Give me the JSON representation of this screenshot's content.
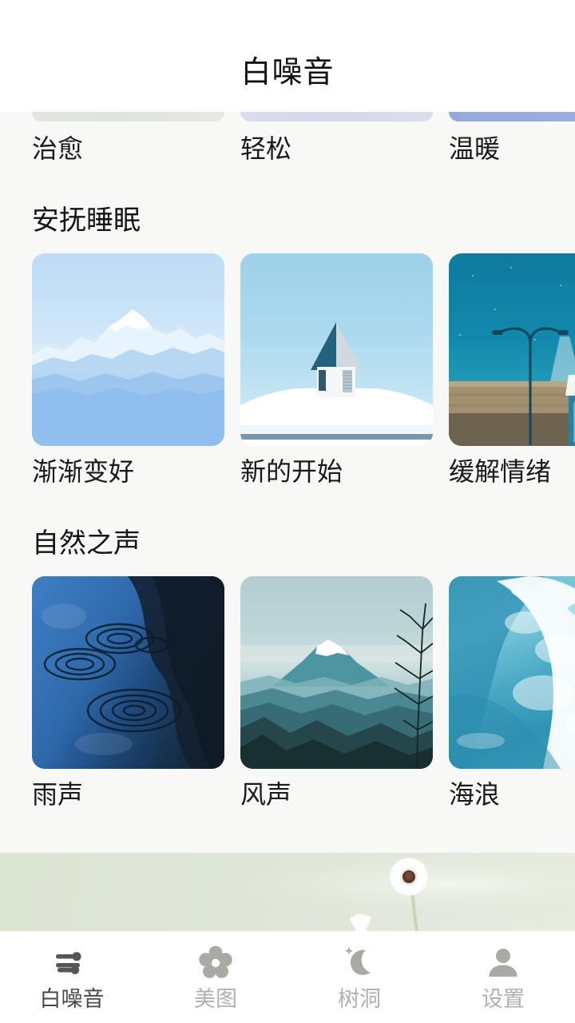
{
  "header": {
    "title": "白噪音"
  },
  "sections": [
    {
      "name": "partial-top",
      "title": "",
      "cards": [
        {
          "label": "治愈",
          "art": "healing",
          "color": "#dfe3e0"
        },
        {
          "label": "轻松",
          "art": "relax",
          "color": "#d6dbe8"
        },
        {
          "label": "温暖",
          "art": "warm",
          "color": "#9aabd8"
        }
      ]
    },
    {
      "name": "soothe-sleep",
      "title": "安抚睡眠",
      "cards": [
        {
          "label": "渐渐变好",
          "art": "snow-mountain",
          "color": "#a8cdee"
        },
        {
          "label": "新的开始",
          "art": "snow-house",
          "color": "#9fd0e8"
        },
        {
          "label": "缓解情绪",
          "art": "street-lamp",
          "color": "#1a7fa8"
        }
      ]
    },
    {
      "name": "nature-sounds",
      "title": "自然之声",
      "cards": [
        {
          "label": "雨声",
          "art": "rain-ripples",
          "color": "#2a62a8"
        },
        {
          "label": "风声",
          "art": "fuji-mountain",
          "color": "#a9c8ca"
        },
        {
          "label": "海浪",
          "art": "ocean-wave",
          "color": "#64bed2"
        }
      ]
    }
  ],
  "banner": {
    "art": "white-daisy-on-green",
    "color": "#dde5d5"
  },
  "tabbar": {
    "items": [
      {
        "label": "白噪音",
        "icon": "wind-icon",
        "active": true
      },
      {
        "label": "美图",
        "icon": "flower-icon",
        "active": false
      },
      {
        "label": "树洞",
        "icon": "moon-sparkle-icon",
        "active": false
      },
      {
        "label": "设置",
        "icon": "person-icon",
        "active": false
      }
    ]
  },
  "colors": {
    "page_bg": "#f8f8f7",
    "header_bg": "#ffffff",
    "text_primary": "#141414",
    "tab_active": "#4a4a4a",
    "tab_inactive": "#b0b0b0"
  }
}
